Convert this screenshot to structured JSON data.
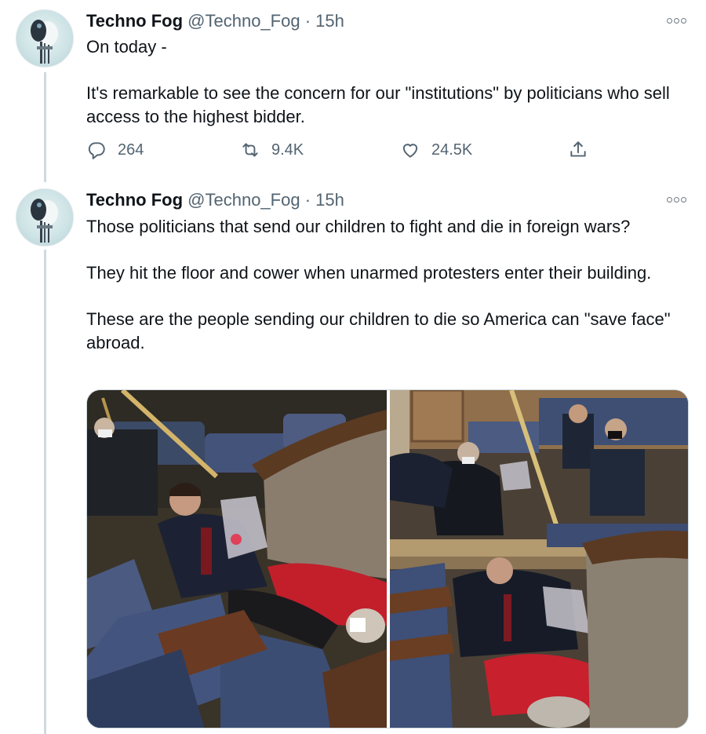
{
  "tweets": [
    {
      "author_name": "Techno Fog",
      "handle": "@Techno_Fog",
      "time": "15h",
      "separator": "·",
      "paragraphs": [
        "On today -",
        "It's remarkable to see the concern for our \"institutions\" by politicians who sell access to the highest bidder."
      ],
      "stats": {
        "replies": "264",
        "retweets": "9.4K",
        "likes": "24.5K"
      }
    },
    {
      "author_name": "Techno Fog",
      "handle": "@Techno_Fog",
      "time": "15h",
      "separator": "·",
      "paragraphs": [
        "Those politicians that send our children to fight and die in foreign wars?",
        "They hit the floor and cower when unarmed protesters enter their building.",
        "These are the people sending our children to die so America can \"save face\" abroad."
      ]
    }
  ],
  "icons": {
    "more": "more-options-icon",
    "reply": "reply-icon",
    "retweet": "retweet-icon",
    "like": "like-icon",
    "share": "share-icon"
  },
  "colors": {
    "text": "#0f1419",
    "muted": "#536471",
    "thread_line": "#cfd9de"
  }
}
